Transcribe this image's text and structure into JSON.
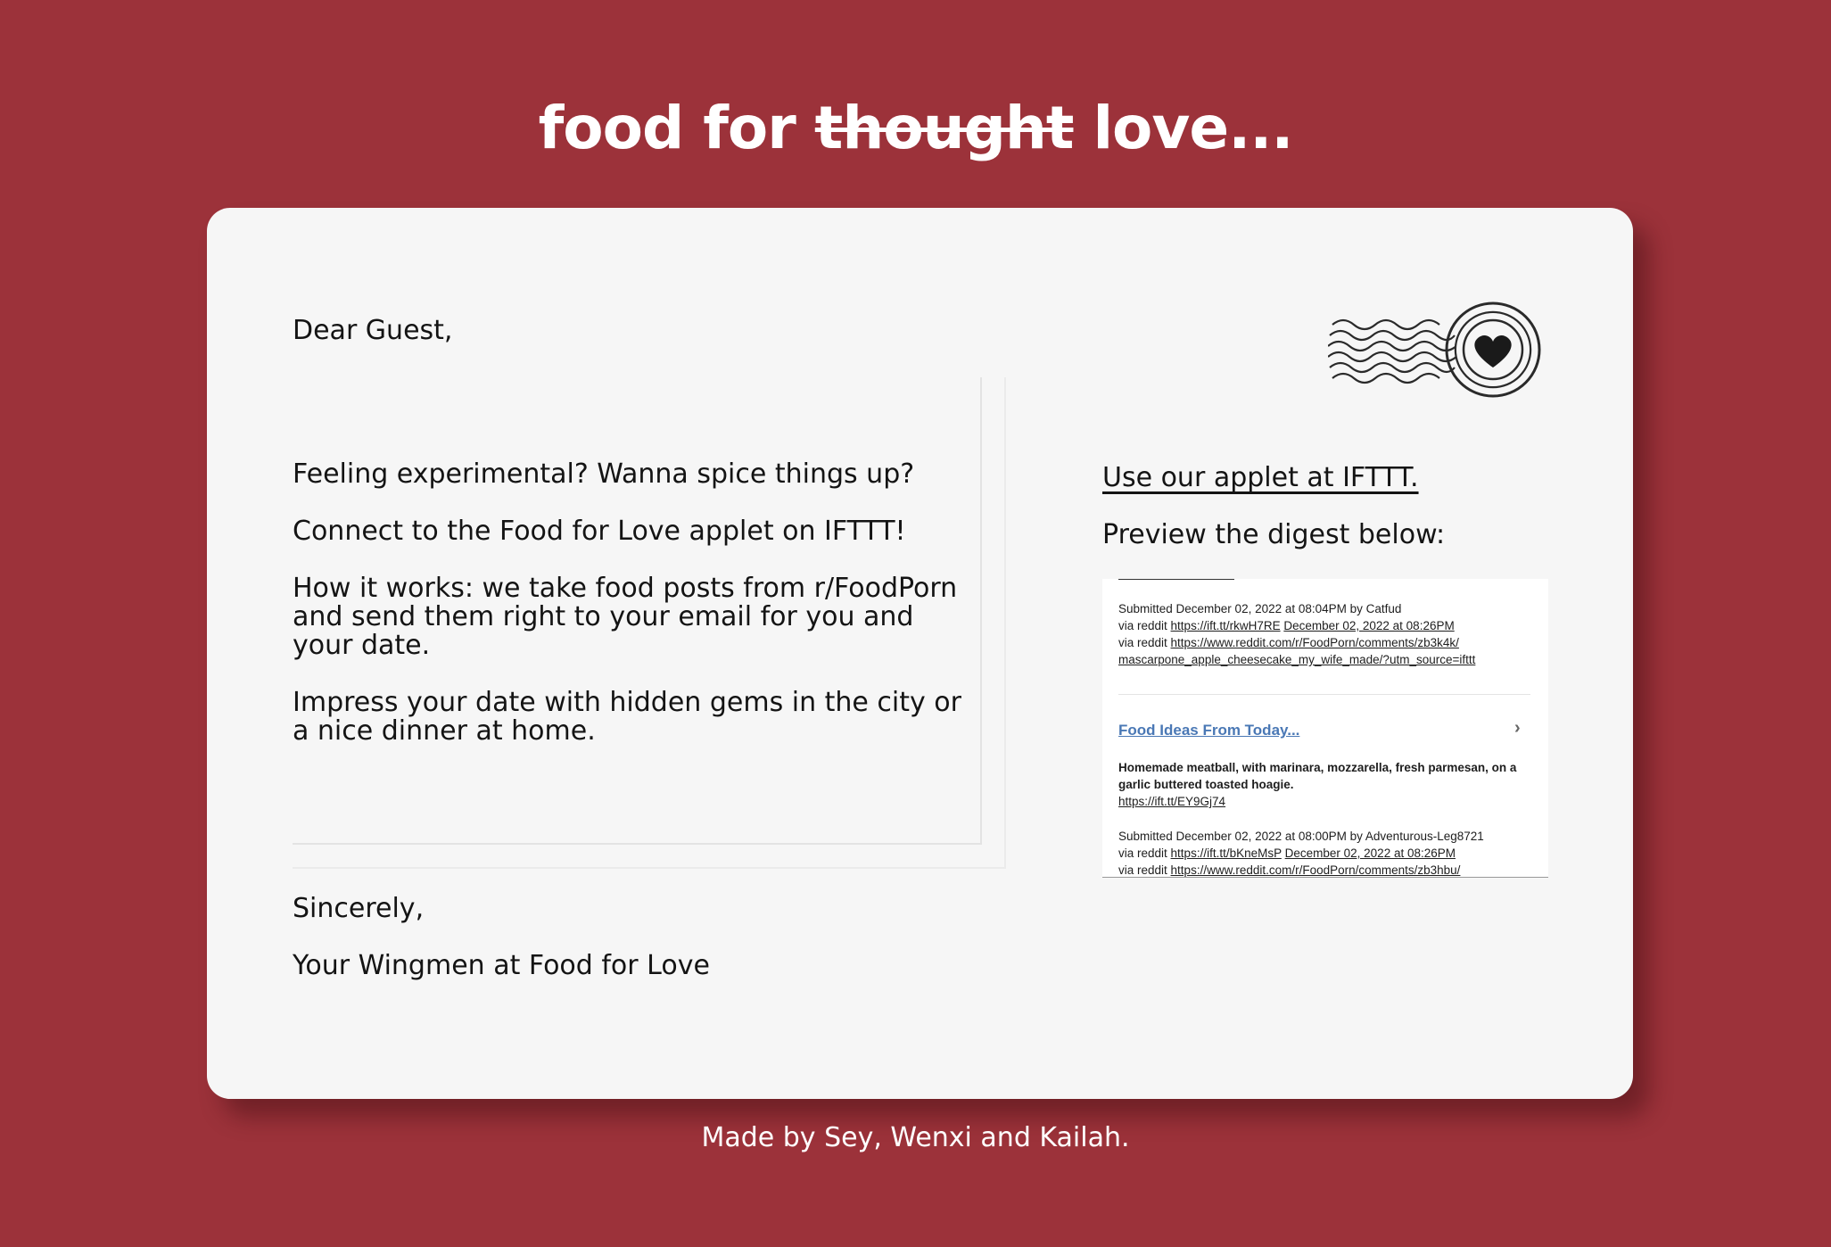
{
  "header": {
    "title_prefix": "food for",
    "title_struck": "thought",
    "title_suffix": "love..."
  },
  "letter": {
    "greeting": "Dear Guest,",
    "paragraphs": [
      "Feeling experimental? Wanna spice things up?",
      "Connect to the Food for Love applet on IFTTT!",
      "How it works: we take food posts from r/FoodPorn and send them right to your email for you and your date.",
      "Impress your date with hidden gems in the city or a nice dinner at home."
    ],
    "closing": "Sincerely,",
    "signature": "Your Wingmen at Food for Love"
  },
  "sidebar": {
    "applet_link": "Use our applet at IFTTT.",
    "preview_label": "Preview the digest below:",
    "stamp_icon": "heart-postmark-icon"
  },
  "digest": {
    "post1": {
      "submitted": "Submitted December 02, 2022 at 08:04PM by Catfud",
      "via1_prefix": "via reddit",
      "via1_link": "https://ift.tt/rkwH7RE",
      "via1_date": "December 02, 2022 at 08:26PM",
      "via2_prefix": "via reddit",
      "via2_link": "https://www.reddit.com/r/FoodPorn/comments/zb3k4k/",
      "via2_link_cont": "mascarpone_apple_cheesecake_my_wife_made/?utm_source=ifttt"
    },
    "section_heading": "Food Ideas From Today...",
    "chevron_icon": "chevron-right-icon",
    "post2": {
      "title_line1": "Homemade meatball, with marinara, mozzarella, fresh parmesan, on a",
      "title_line2": "garlic buttered toasted hoagie.",
      "short_link": "https://ift.tt/EY9Gj74",
      "submitted": "Submitted December 02, 2022 at 08:00PM by Adventurous-Leg8721",
      "via1_prefix": "via reddit",
      "via1_link": "https://ift.tt/bKneMsP",
      "via1_date": "December 02, 2022 at 08:26PM",
      "via2_prefix": "via reddit",
      "via2_link": "https://www.reddit.com/r/FoodPorn/comments/zb3hbu/"
    }
  },
  "footer": {
    "credits": "Made by Sey, Wenxi and Kailah."
  },
  "colors": {
    "background": "#9c323a",
    "card": "#f6f6f6",
    "text": "#141414",
    "digest_heading": "#4a78b5"
  }
}
